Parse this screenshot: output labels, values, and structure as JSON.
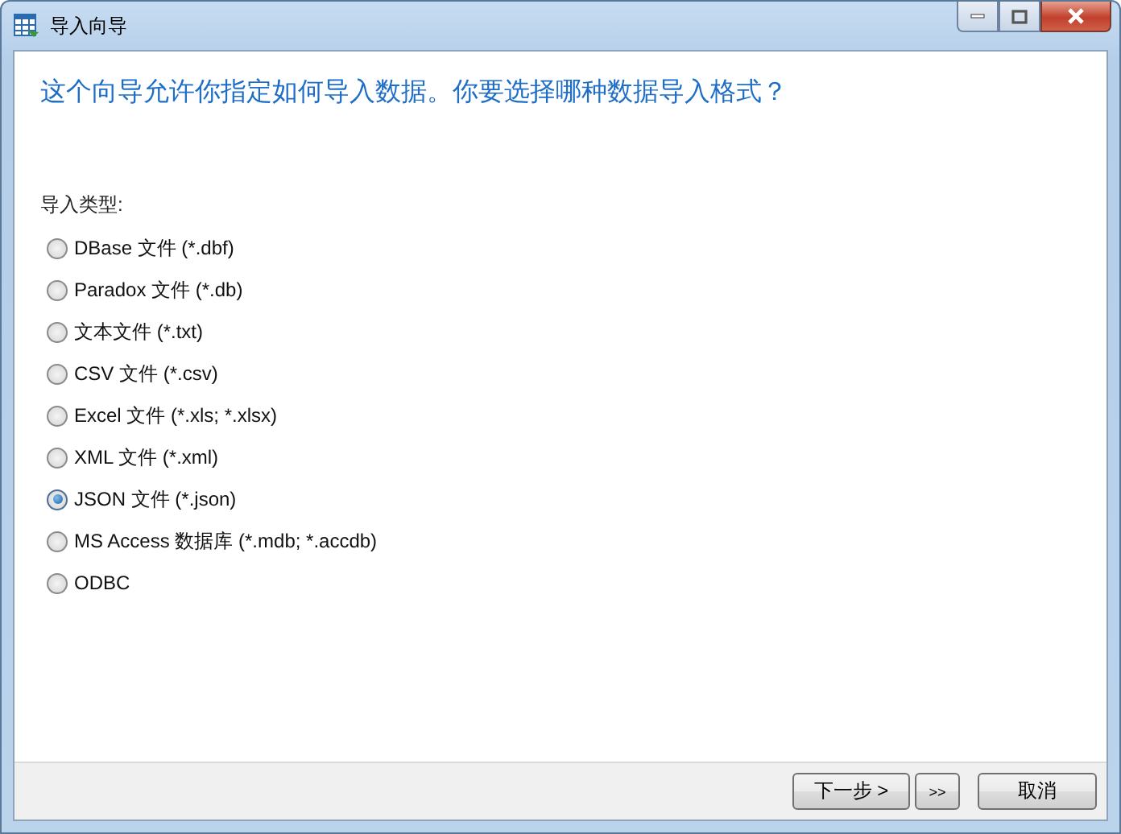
{
  "window": {
    "title": "导入向导"
  },
  "heading": "这个向导允许你指定如何导入数据。你要选择哪种数据导入格式？",
  "group_label": "导入类型:",
  "options": [
    {
      "label": "DBase 文件 (*.dbf)",
      "selected": false
    },
    {
      "label": "Paradox 文件 (*.db)",
      "selected": false
    },
    {
      "label": "文本文件 (*.txt)",
      "selected": false
    },
    {
      "label": "CSV 文件 (*.csv)",
      "selected": false
    },
    {
      "label": "Excel 文件 (*.xls; *.xlsx)",
      "selected": false
    },
    {
      "label": "XML 文件 (*.xml)",
      "selected": false
    },
    {
      "label": "JSON 文件 (*.json)",
      "selected": true
    },
    {
      "label": "MS Access 数据库 (*.mdb; *.accdb)",
      "selected": false
    },
    {
      "label": "ODBC",
      "selected": false
    }
  ],
  "buttons": [
    {
      "label": "下一步 >",
      "kind": "next"
    },
    {
      "label": ">>",
      "kind": "last"
    },
    {
      "label": "取消",
      "kind": "cancel"
    }
  ]
}
